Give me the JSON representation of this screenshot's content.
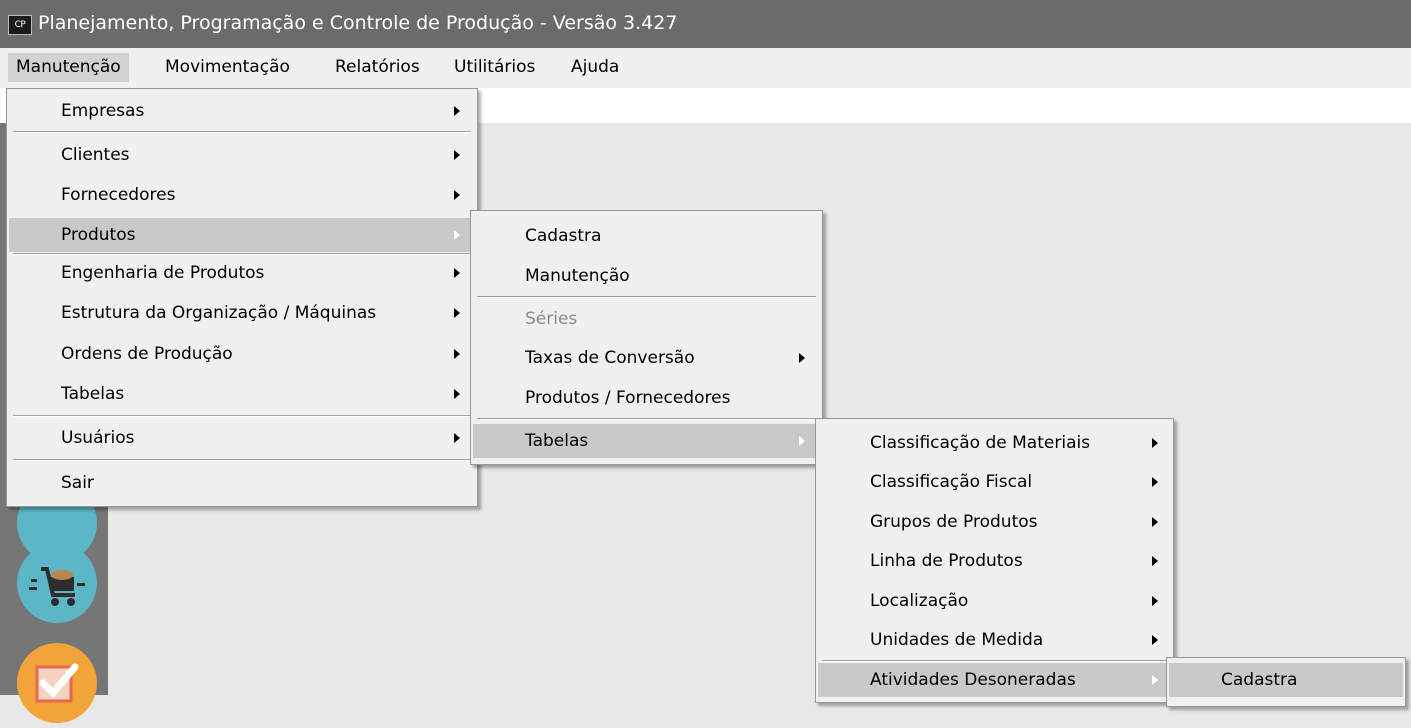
{
  "window": {
    "title": "Planejamento, Programação e Controle de Produção - Versão 3.427",
    "app_icon_text": "CP"
  },
  "menubar": {
    "items": [
      "Manutenção",
      "Movimentação",
      "Relatórios",
      "Utilitários",
      "Ajuda"
    ],
    "active": "Manutenção"
  },
  "menu_manutencao": {
    "items": [
      {
        "label": "Empresas",
        "submenu": true
      },
      {
        "label": "Clientes",
        "submenu": true
      },
      {
        "label": "Fornecedores",
        "submenu": true
      },
      {
        "label": "Produtos",
        "submenu": true,
        "highlighted": true
      },
      {
        "label": "Engenharia de Produtos",
        "submenu": true
      },
      {
        "label": "Estrutura da Organização / Máquinas",
        "submenu": true
      },
      {
        "label": "Ordens de Produção",
        "submenu": true
      },
      {
        "label": "Tabelas",
        "submenu": true
      },
      {
        "label": "Usuários",
        "submenu": true
      },
      {
        "label": "Sair",
        "submenu": false
      }
    ]
  },
  "menu_produtos": {
    "items": [
      {
        "label": "Cadastra",
        "submenu": false
      },
      {
        "label": "Manutenção",
        "submenu": false
      },
      {
        "label": "Séries",
        "submenu": false,
        "disabled": true
      },
      {
        "label": "Taxas de Conversão",
        "submenu": true
      },
      {
        "label": "Produtos / Fornecedores",
        "submenu": false
      },
      {
        "label": "Tabelas",
        "submenu": true,
        "highlighted": true
      }
    ]
  },
  "menu_tabelas": {
    "items": [
      {
        "label": "Classificação de Materiais",
        "submenu": true
      },
      {
        "label": "Classificação Fiscal",
        "submenu": true
      },
      {
        "label": "Grupos de Produtos",
        "submenu": true
      },
      {
        "label": "Linha de Produtos",
        "submenu": true
      },
      {
        "label": "Localização",
        "submenu": true
      },
      {
        "label": "Unidades de Medida",
        "submenu": true
      },
      {
        "label": "Atividades Desoneradas",
        "submenu": true,
        "highlighted": true
      }
    ]
  },
  "menu_atividades": {
    "items": [
      {
        "label": "Cadastra",
        "submenu": false
      }
    ]
  },
  "sidebar_icons": [
    "cart-icon",
    "checkmark-box-icon"
  ],
  "colors": {
    "title_bar": "#6b6b6b",
    "highlight": "#c9c9c9",
    "sidebar": "#767676",
    "icon_cart_bg": "#5bb7c6",
    "icon_check_bg": "#f2a43a"
  }
}
